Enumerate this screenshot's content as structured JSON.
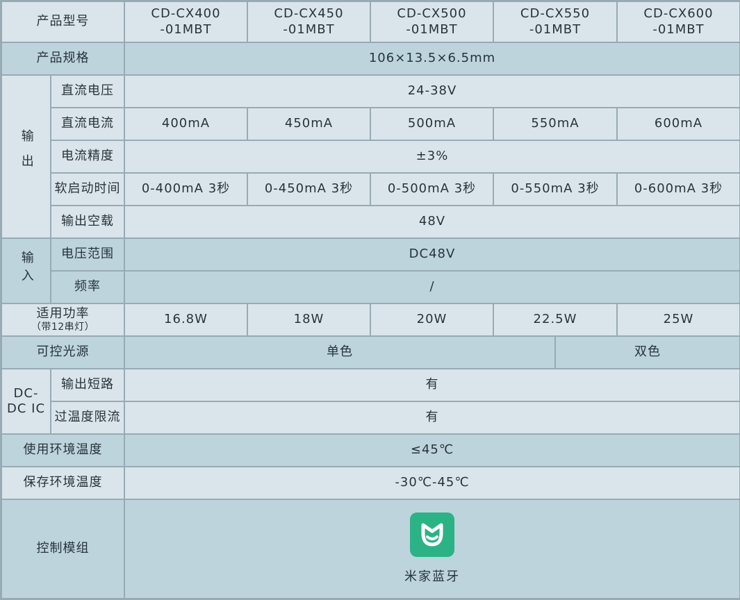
{
  "header": {
    "label": "产品型号",
    "models": [
      {
        "l1": "CD-CX400",
        "l2": "-01MBT"
      },
      {
        "l1": "CD-CX450",
        "l2": "-01MBT"
      },
      {
        "l1": "CD-CX500",
        "l2": "-01MBT"
      },
      {
        "l1": "CD-CX550",
        "l2": "-01MBT"
      },
      {
        "l1": "CD-CX600",
        "l2": "-01MBT"
      }
    ]
  },
  "spec": {
    "label": "产品规格",
    "value": "106×13.5×6.5mm"
  },
  "output": {
    "group": "输出",
    "dc_voltage": {
      "label": "直流电压",
      "value": "24-38V"
    },
    "dc_current": {
      "label": "直流电流",
      "values": [
        "400mA",
        "450mA",
        "500mA",
        "550mA",
        "600mA"
      ]
    },
    "precision": {
      "label": "电流精度",
      "value": "±3%"
    },
    "soft_start": {
      "label": "软启动时间",
      "values": [
        "0-400mA 3秒",
        "0-450mA 3秒",
        "0-500mA 3秒",
        "0-550mA 3秒",
        "0-600mA 3秒"
      ]
    },
    "no_load": {
      "label": "输出空载",
      "value": "48V"
    }
  },
  "input": {
    "group": "输入",
    "voltage_range": {
      "label": "电压范围",
      "value": "DC48V"
    },
    "frequency": {
      "label": "频率",
      "value": "/"
    }
  },
  "power": {
    "label": "适用功率",
    "sublabel": "（带12串灯）",
    "values": [
      "16.8W",
      "18W",
      "20W",
      "22.5W",
      "25W"
    ]
  },
  "light_source": {
    "label": "可控光源",
    "values": [
      "单色",
      "双色"
    ]
  },
  "ic": {
    "group": "DC-DC IC",
    "short_circuit": {
      "label": "输出短路",
      "value": "有"
    },
    "over_temp": {
      "label": "过温度限流",
      "value": "有"
    }
  },
  "env_temp": {
    "label": "使用环境温度",
    "value": "≤45℃"
  },
  "storage_temp": {
    "label": "保存环境温度",
    "value": "-30℃-45℃"
  },
  "control": {
    "label": "控制模组",
    "module_name": "米家蓝牙",
    "icon": "mijia-icon",
    "icon_color": "#2bb386"
  }
}
